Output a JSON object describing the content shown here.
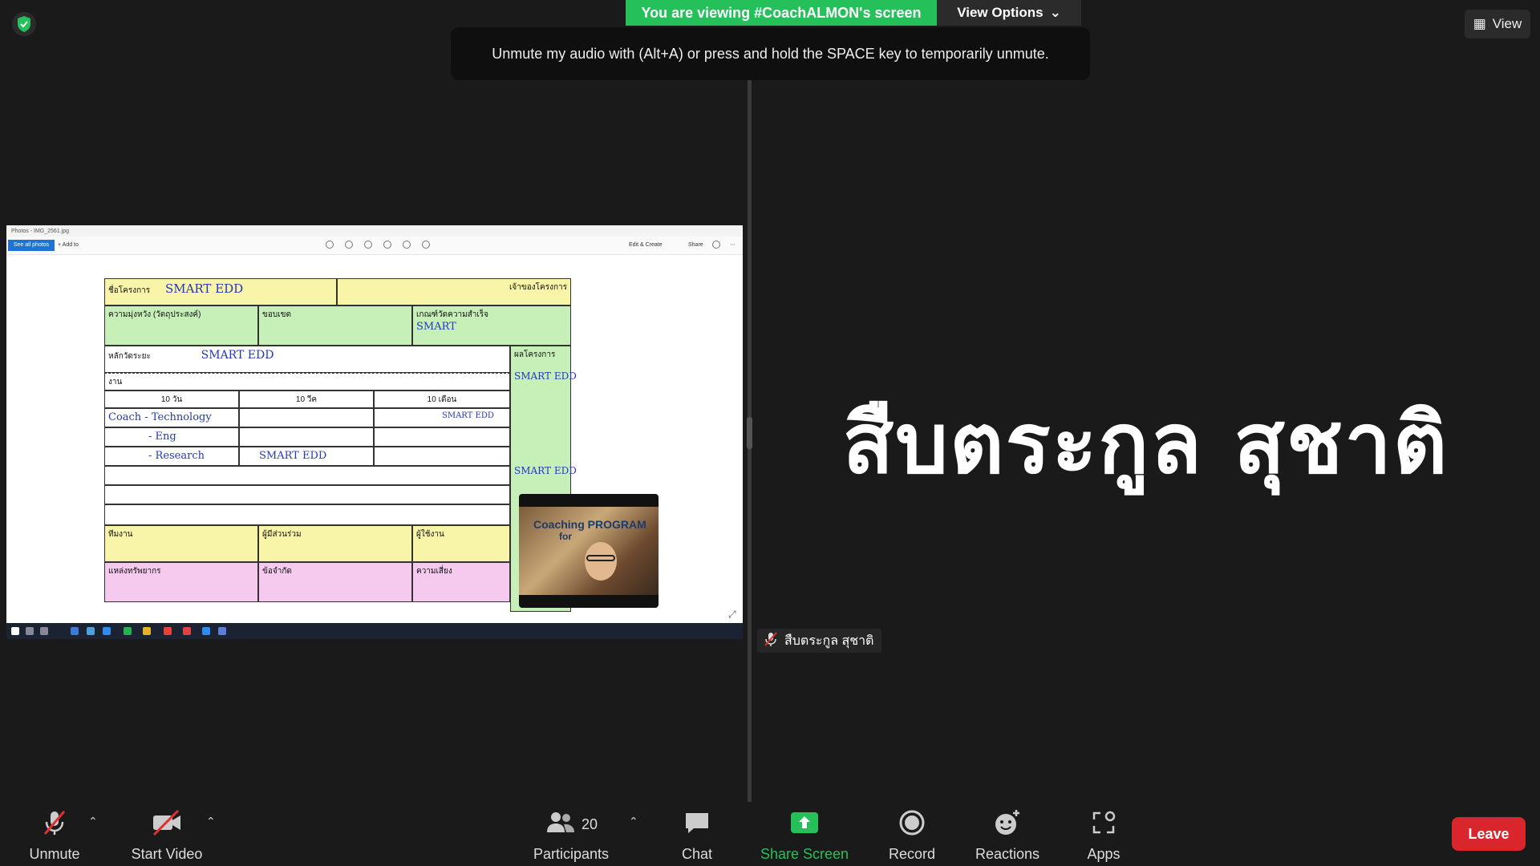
{
  "top": {
    "viewing_banner": "You are viewing #CoachALMON's screen",
    "view_options_label": "View Options",
    "view_label": "View",
    "unmute_tip": "Unmute my audio with (Alt+A) or press and hold the SPACE key to temporarily unmute."
  },
  "shared_screen": {
    "window_title": "Photos - IMG_2561.jpg",
    "see_all_photos": "See all photos",
    "add_to": "+ Add to",
    "edit_create": "Edit & Create",
    "share": "Share",
    "form": {
      "project_name_label": "ชื่อโครงการ",
      "project_name_value": "SMART EDD",
      "owner_label": "เจ้าของโครงการ",
      "goal_label": "ความมุ่งหวัง (วัตถุประสงค์)",
      "scope_label": "ขอบเขต",
      "kpi_label": "เกณฑ์วัดความสำเร็จ",
      "kpi_value": "SMART",
      "milestone_label": "หลักวัดระยะ",
      "milestone_value": "SMART EDD",
      "result_label": "ผลโครงการ",
      "result_value": "SMART EDD",
      "work_label": "งาน",
      "col1": "10 วัน",
      "col2": "10 วีค",
      "col3": "10 เดือน",
      "row_coach": "Coach - Technology",
      "row_eng": "- Eng",
      "row_research": "- Research",
      "row_smart": "SMART EDD",
      "row_smart_edd_small": "SMART EDD",
      "result_smart": "SMART EDD",
      "team_label": "ทีมงาน",
      "participants_label": "ผู้มีส่วนร่วม",
      "users_label": "ผู้ใช้งาน",
      "resources_label": "แหล่งทรัพยากร",
      "constraints_label": "ข้อจำกัด",
      "risk_label": "ความเสี่ยง"
    },
    "cam": {
      "title": "Coaching PROGRAM",
      "sub": "for"
    }
  },
  "participant": {
    "big_name": "สืบตระกูล สุชาติ",
    "name_tag": "สืบตระกูล สุชาติ"
  },
  "toolbar": {
    "unmute": "Unmute",
    "start_video": "Start Video",
    "participants": "Participants",
    "participants_count": "20",
    "chat": "Chat",
    "share_screen": "Share Screen",
    "record": "Record",
    "reactions": "Reactions",
    "apps": "Apps",
    "leave": "Leave"
  },
  "colors": {
    "banner_green": "#25c05a",
    "leave_red": "#d9262c",
    "background": "#1a1a1a"
  }
}
